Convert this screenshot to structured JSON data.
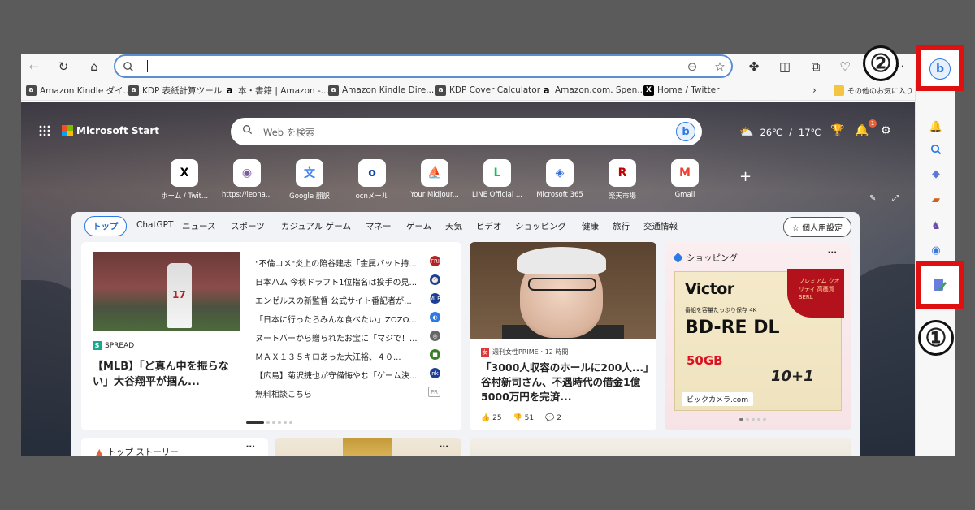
{
  "toolbar": {
    "back_icon": "←",
    "reload_icon": "↻",
    "home_icon": "⌂",
    "url_value": "",
    "zoom_icon": "⊖",
    "fav_icon": "☆",
    "ext_icon": "✤",
    "split_icon": "◫",
    "collections_icon": "⧉",
    "browser_ess_icon": "♡",
    "more_icon": "···"
  },
  "bookmarks": [
    {
      "label": "Amazon Kindle ダイ...",
      "icon": "amz"
    },
    {
      "label": "KDP 表紙計算ツール",
      "icon": "amz"
    },
    {
      "label": "本・書籍 | Amazon -...",
      "icon": "a"
    },
    {
      "label": "Amazon Kindle Dire...",
      "icon": "amz"
    },
    {
      "label": "KDP Cover Calculator",
      "icon": "amz"
    },
    {
      "label": "Amazon.com. Spen...",
      "icon": "a"
    },
    {
      "label": "Home / Twitter",
      "icon": "x"
    }
  ],
  "bookmarks_more": "›",
  "bookmarks_other": "その他のお気に入り",
  "header": {
    "brand": "Microsoft Start",
    "search_placeholder": "Web を検索",
    "weather_high": "26℃",
    "weather_sep": "/",
    "weather_low": "17℃",
    "notif_count": "1"
  },
  "quick_links": [
    {
      "label": "ホーム / Twit...",
      "glyph": "X",
      "color": "#000000"
    },
    {
      "label": "https://leona...",
      "glyph": "◉",
      "color": "#7a5a9a"
    },
    {
      "label": "Google 翻訳",
      "glyph": "文",
      "color": "#4285f4"
    },
    {
      "label": "ocnメール",
      "glyph": "o",
      "color": "#0a3fa8"
    },
    {
      "label": "Your Midjour...",
      "glyph": "⛵",
      "color": "#111111"
    },
    {
      "label": "LINE Official ...",
      "glyph": "L",
      "color": "#06c755"
    },
    {
      "label": "Microsoft 365",
      "glyph": "◈",
      "color": "#3b6fe0"
    },
    {
      "label": "楽天市場",
      "glyph": "R",
      "color": "#bf0000"
    },
    {
      "label": "Gmail",
      "glyph": "M",
      "color": "#ea4335"
    }
  ],
  "nav": {
    "tabs": [
      "トップ",
      "ChatGPT",
      "ニュース",
      "スポーツ",
      "カジュアル ゲーム",
      "マネー",
      "ゲーム",
      "天気",
      "ビデオ",
      "ショッピング",
      "健康",
      "旅行",
      "交通情報"
    ],
    "personal": "個人用設定"
  },
  "card1": {
    "source": "SPREAD",
    "title": "【MLB】「ど真ん中を振らない」大谷翔平が掴ん...",
    "jersey": "17",
    "headlines": [
      {
        "text": "\"不倫コメ\"炎上の陪谷建志「金属バット持...",
        "src": "FRI",
        "color": "#b22222"
      },
      {
        "text": "日本ハム 今秋ドラフト1位指名は投手の見...",
        "src": "⚾",
        "color": "#1c3f94"
      },
      {
        "text": "エンゼルスの新監督 公式サイト番記者が...",
        "src": "MLB",
        "color": "#1c3f94"
      },
      {
        "text": "「日本に行ったらみんな食べたい」ZOZO...",
        "src": "◐",
        "color": "#2c7be5"
      },
      {
        "text": "ヌートバーから贈られたお宝に「マジで！...",
        "src": "◎",
        "color": "#666666"
      },
      {
        "text": "ＭＡＸ１３５キロあった大江裕、４０...",
        "src": "■",
        "color": "#3a7d2a"
      },
      {
        "text": "【広島】菊沢捷也が守備悔やむ「ゲーム決...",
        "src": "nk",
        "color": "#1c3f94"
      },
      {
        "text": "無料相談こちら",
        "src": "PR",
        "color": "#888888"
      }
    ]
  },
  "card2": {
    "source": "週刊女性PRIME・12 時間",
    "title": "「3000人収容のホールに200人...」谷村新司さん、不遇時代の借金1億5000万円を完済...",
    "likes": "25",
    "dislikes": "51",
    "comments": "2"
  },
  "card3": {
    "header": "ショッピング",
    "more": "···",
    "brand": "Victor",
    "premium": "プレミアム クオリティ 高画質 SERL",
    "sub": "番組を容量たっぷり保存 4K",
    "product": "BD-RE DL",
    "capacity": "50GB",
    "pack": "10+1",
    "shop": "ビックカメラ.com"
  },
  "card4": {
    "title": "トップ ストーリー",
    "more": "···"
  },
  "sidebar_icons": [
    "bing",
    "bell",
    "search",
    "tag",
    "briefcase",
    "chess",
    "circle",
    "outlook",
    "edit",
    "bottom"
  ],
  "annotations": {
    "one": "①",
    "two": "②"
  },
  "colors": {
    "accent": "#2c7be5",
    "highlight_box": "#e01010"
  }
}
